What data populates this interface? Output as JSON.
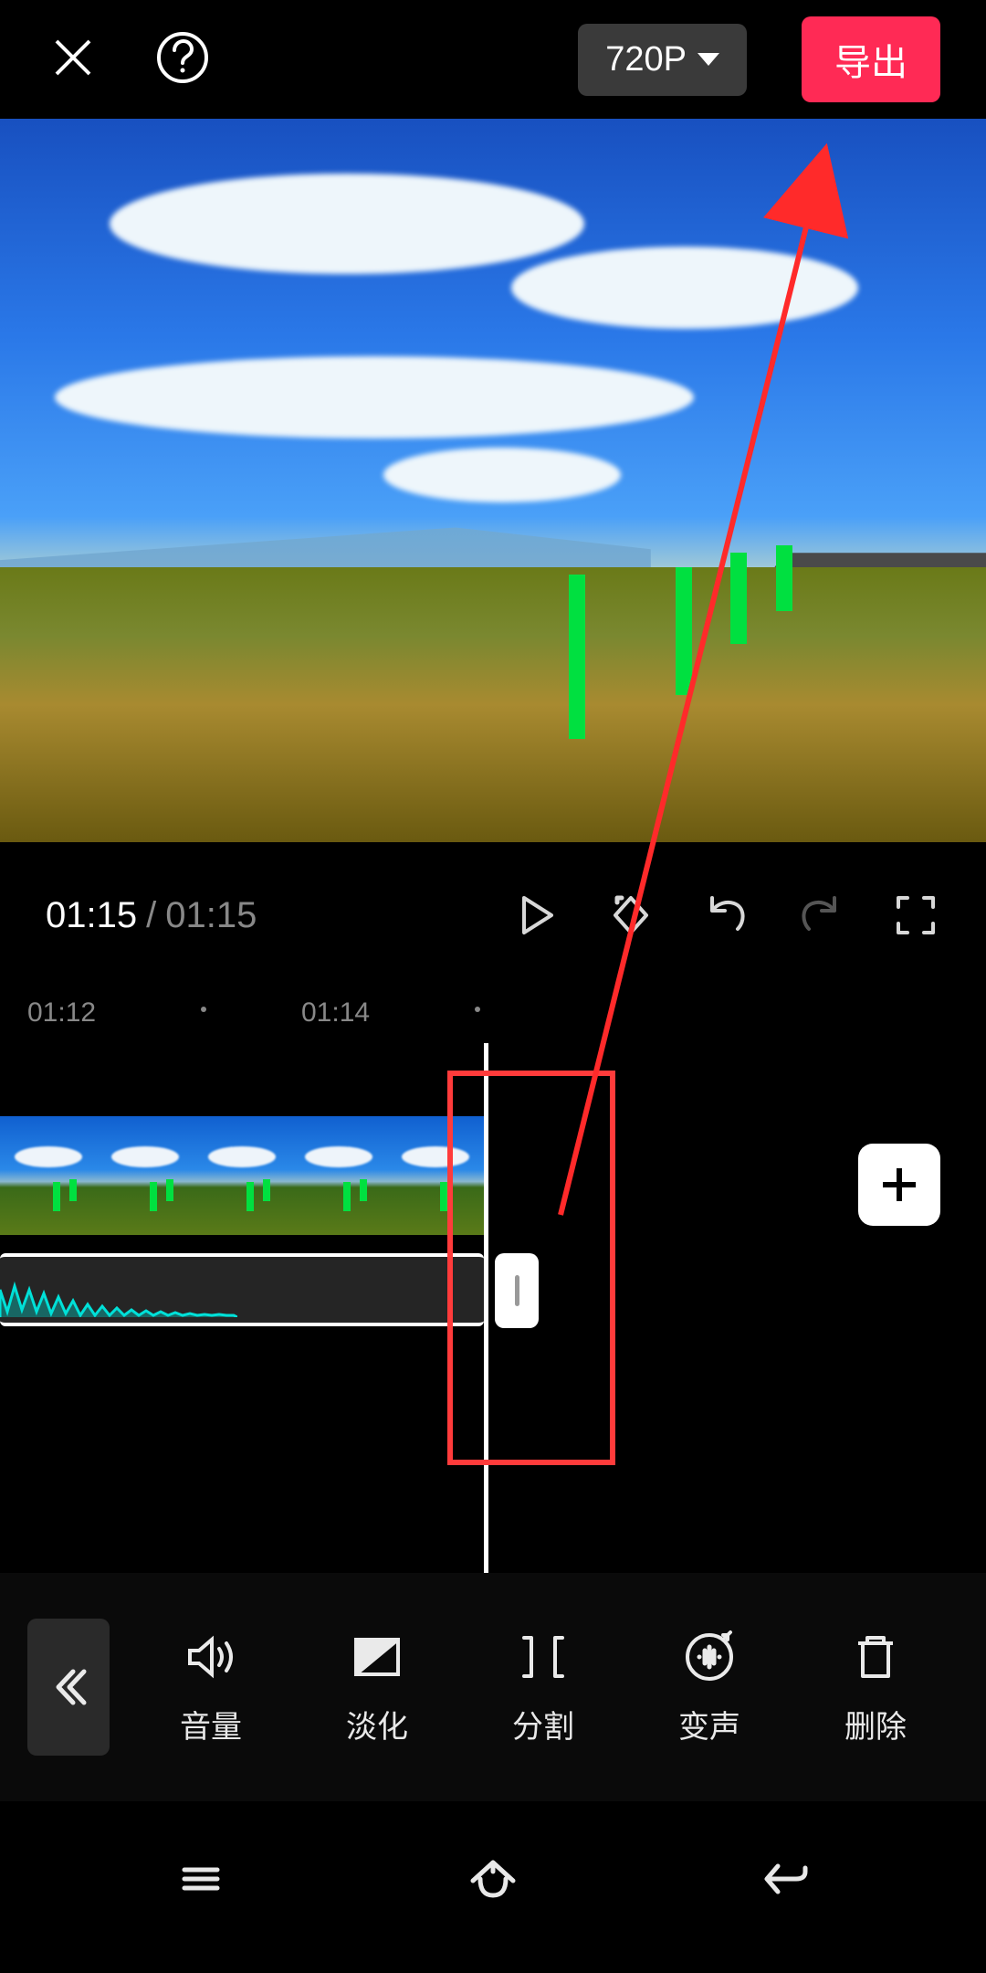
{
  "header": {
    "resolution_label": "720P",
    "export_label": "导出"
  },
  "transport": {
    "current_time": "01:15",
    "separator": " / ",
    "total_time": "01:15"
  },
  "timeline": {
    "ticks": [
      "01:12",
      "01:14"
    ]
  },
  "tools": {
    "volume": "音量",
    "fade": "淡化",
    "split": "分割",
    "voice": "变声",
    "delete": "删除"
  }
}
